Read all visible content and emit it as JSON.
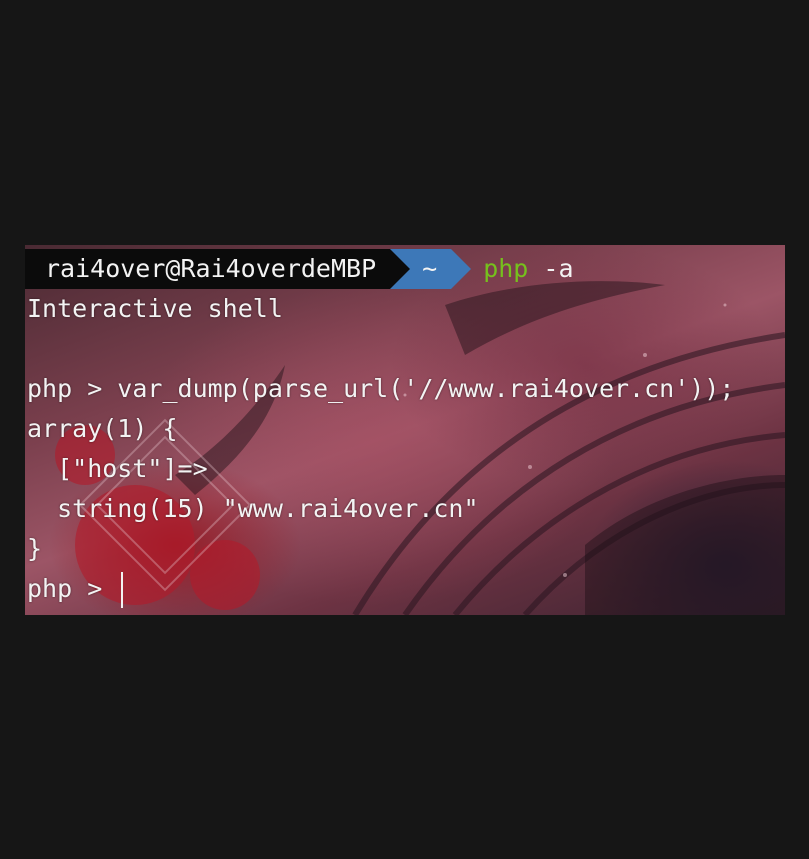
{
  "prompt": {
    "user_host": "rai4over@Rai4overdeMBP",
    "directory": "~",
    "command": "php",
    "argument": "-a"
  },
  "output": {
    "line1": "Interactive shell",
    "line2": "",
    "line3": "php > var_dump(parse_url('//www.rai4over.cn'));",
    "line4": "array(1) {",
    "line5": "  [\"host\"]=>",
    "line6": "  string(15) \"www.rai4over.cn\"",
    "line7": "}",
    "line8": "php > "
  },
  "colors": {
    "user_segment_bg": "#0b0b0b",
    "dir_segment_bg": "#3d78b8",
    "command_color": "#76c01d",
    "text_color": "#f3f3f3",
    "page_bg": "#161616"
  }
}
